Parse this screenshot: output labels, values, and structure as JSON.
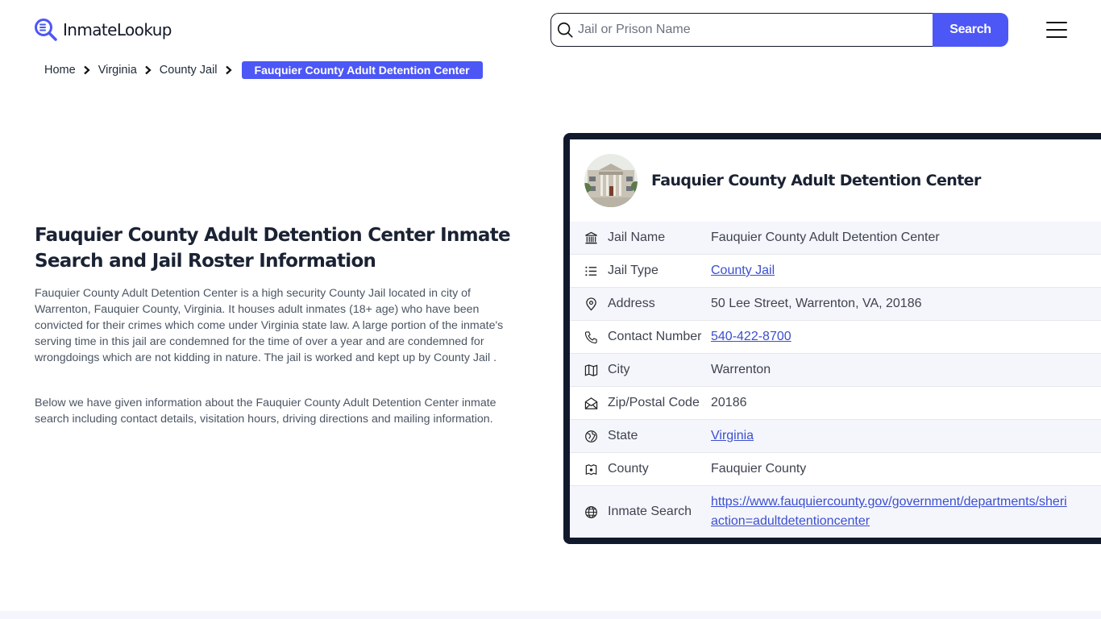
{
  "header": {
    "logo_text": "InmateLookup",
    "search_placeholder": "Jail or Prison Name",
    "search_value": "",
    "search_button": "Search",
    "brand_color": "#4c57f5"
  },
  "breadcrumb": {
    "items": [
      "Home",
      "Virginia",
      "County Jail"
    ],
    "current": "Fauquier County Adult Detention Center"
  },
  "main": {
    "title": "Fauquier County Adult Detention Center Inmate Search and Jail Roster Information",
    "paragraphs": [
      "Fauquier County Adult Detention Center is a high security County Jail located in city of Warrenton, Fauquier County, Virginia. It houses adult inmates (18+ age) who have been convicted for their crimes which come under Virginia state law. A large portion of the inmate's serving time in this jail are condemned for the time of over a year and are condemned for wrongdoings which are not kidding in nature. The jail is worked and kept up by County Jail .",
      "Below we have given information about the Fauquier County Adult Detention Center inmate search including contact details, visitation hours, driving directions and mailing information."
    ]
  },
  "card": {
    "title": "Fauquier County Adult Detention Center",
    "rows": [
      {
        "icon": "bank-icon",
        "label": "Jail Name",
        "value": "Fauquier County Adult Detention Center",
        "link": false
      },
      {
        "icon": "list-icon",
        "label": "Jail Type",
        "value": "County Jail",
        "link": true
      },
      {
        "icon": "map-pin-icon",
        "label": "Address",
        "value": "50 Lee Street, Warrenton, VA, 20186",
        "link": false
      },
      {
        "icon": "phone-icon",
        "label": "Contact Number",
        "value": "540-422-8700",
        "link": true
      },
      {
        "icon": "map-icon",
        "label": "City",
        "value": "Warrenton",
        "link": false
      },
      {
        "icon": "mail-open-icon",
        "label": "Zip/Postal Code",
        "value": "20186",
        "link": false
      },
      {
        "icon": "globe-region-icon",
        "label": "State",
        "value": "Virginia",
        "link": true
      },
      {
        "icon": "county-map-icon",
        "label": "County",
        "value": "Fauquier County",
        "link": false
      },
      {
        "icon": "globe-icon",
        "label": "Inmate Search",
        "value_line1": "https://www.fauquiercounty.gov/government/departments/sheri",
        "value_line2": "action=adultdetentioncenter",
        "link": true
      }
    ]
  }
}
